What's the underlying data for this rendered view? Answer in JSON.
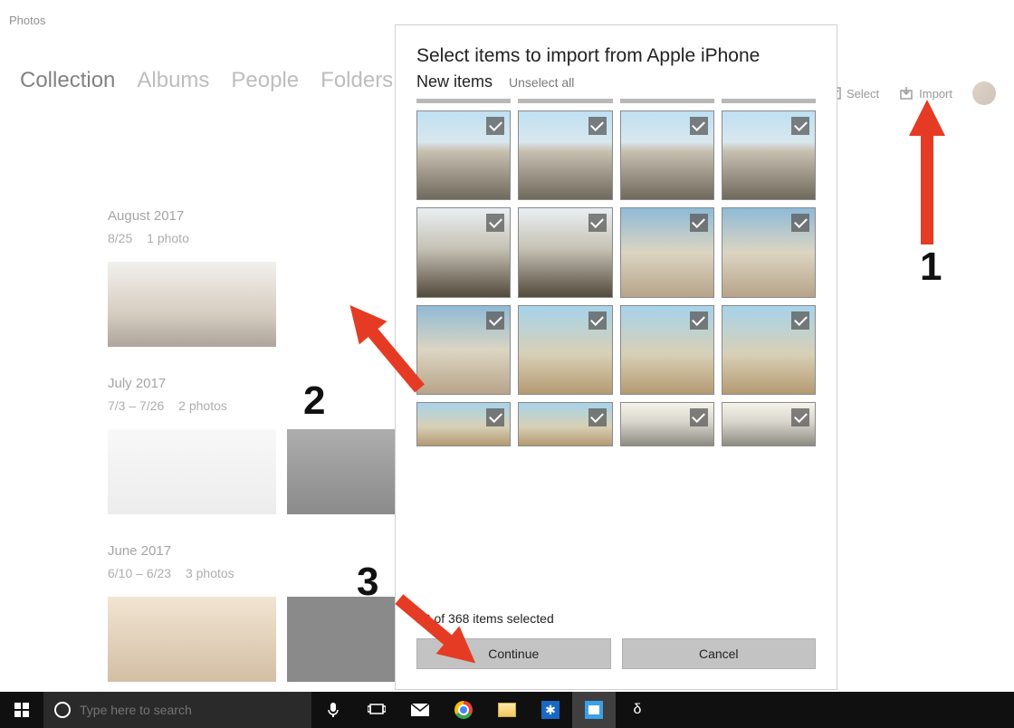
{
  "app": {
    "title": "Photos"
  },
  "nav": {
    "collection": "Collection",
    "albums": "Albums",
    "people": "People",
    "folders": "Folders"
  },
  "toolbar": {
    "select": "Select",
    "import": "Import"
  },
  "feed": {
    "groups": [
      {
        "title": "August 2017",
        "range": "8/25",
        "count": "1 photo"
      },
      {
        "title": "July 2017",
        "range": "7/3 – 7/26",
        "count": "2 photos"
      },
      {
        "title": "June 2017",
        "range": "6/10 – 6/23",
        "count": "3 photos"
      }
    ]
  },
  "dialog": {
    "title": "Select items to import from Apple iPhone",
    "subtitle": "New items",
    "unselect": "Unselect all",
    "status": "23 of 368 items selected",
    "continue": "Continue",
    "cancel": "Cancel"
  },
  "taskbar": {
    "search_placeholder": "Type here to search"
  },
  "annotations": {
    "a1": "1",
    "a2": "2",
    "a3": "3"
  }
}
